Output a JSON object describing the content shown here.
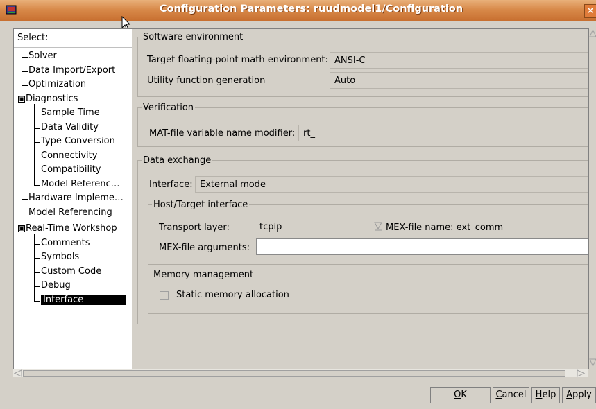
{
  "window": {
    "title": "Configuration Parameters: ruudmodel1/Configuration",
    "close_glyph": "×"
  },
  "tree": {
    "select_label": "Select:",
    "nodes": [
      "Solver",
      "Data Import/Export",
      "Optimization",
      "Diagnostics",
      "Sample Time",
      "Data Validity",
      "Type Conversion",
      "Connectivity",
      "Compatibility",
      "Model Referenc…",
      "Hardware Impleme…",
      "Model Referencing",
      "Real-Time Workshop",
      "Comments",
      "Symbols",
      "Custom Code",
      "Debug",
      "Interface"
    ],
    "selected": "Interface",
    "expander_glyph": "▣"
  },
  "software_env": {
    "legend": "Software environment",
    "target_label": "Target floating-point math environment:",
    "target_value": "ANSI-C",
    "utility_label": "Utility function generation",
    "utility_value": "Auto"
  },
  "verification": {
    "legend": "Verification",
    "mat_label": "MAT-file variable name modifier:",
    "mat_value": "rt_"
  },
  "data_exchange": {
    "legend": "Data exchange",
    "interface_label": "Interface:",
    "interface_value": "External mode",
    "host_target": {
      "legend": "Host/Target interface",
      "transport_label": "Transport layer:",
      "transport_value": "tcpip",
      "mex_name_label": "MEX-file name: ext_comm",
      "mex_args_label": "MEX-file arguments:",
      "mex_args_value": ""
    },
    "memory": {
      "legend": "Memory management",
      "static_label": "Static memory allocation",
      "static_checked": false
    }
  },
  "buttons": {
    "ok_mnemonic": "O",
    "ok_rest": "K",
    "cancel_mnemonic": "C",
    "cancel_rest": "ancel",
    "help_mnemonic": "H",
    "help_rest": "elp",
    "apply_mnemonic": "A",
    "apply_rest": "pply"
  }
}
